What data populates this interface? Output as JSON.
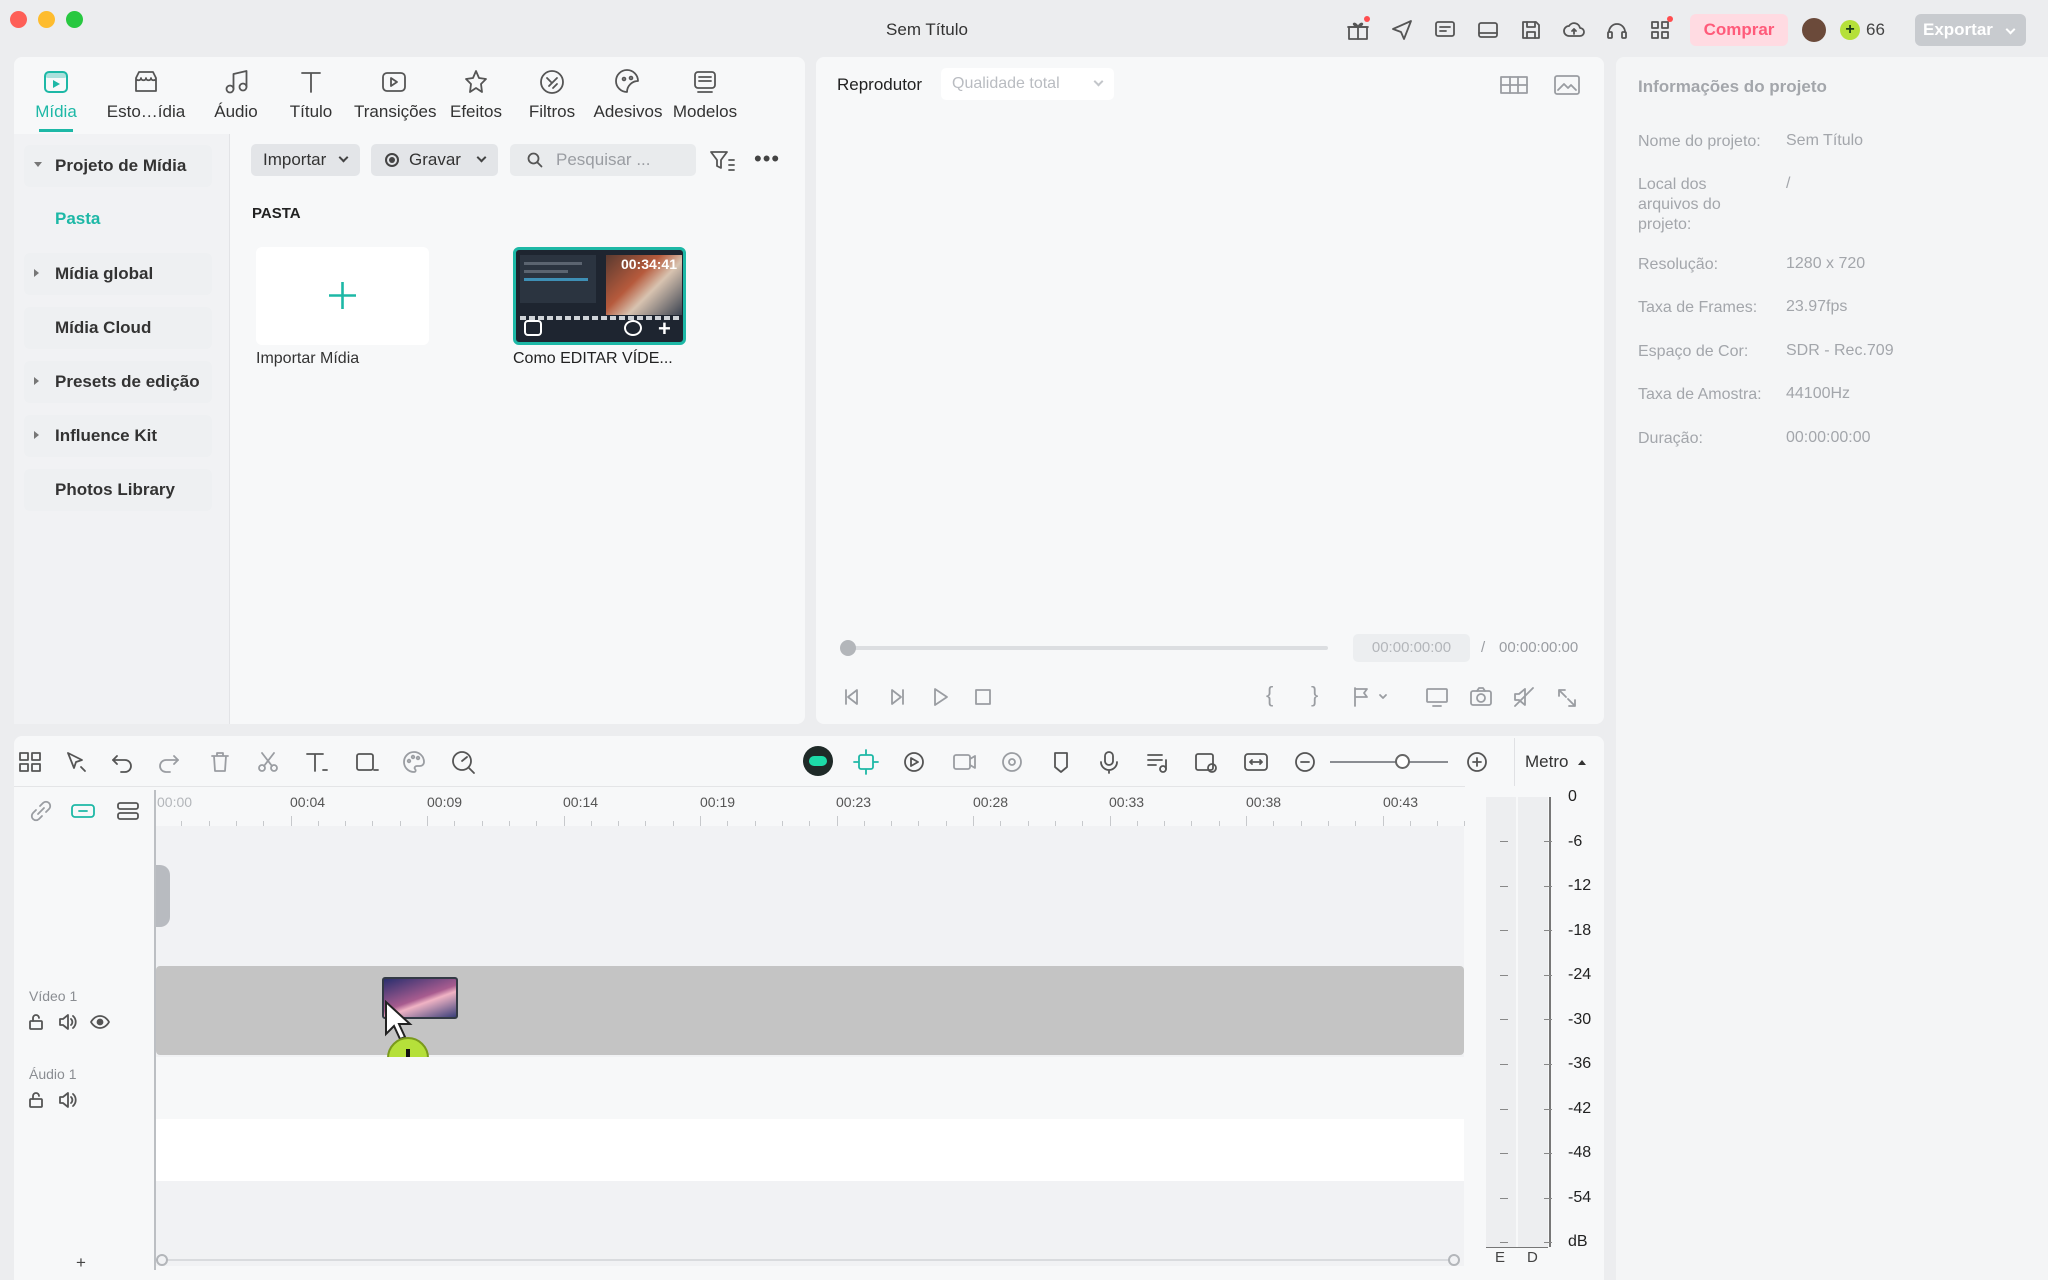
{
  "window": {
    "title": "Sem Título"
  },
  "titlebar": {
    "buy_label": "Comprar",
    "credits": "66",
    "export_label": "Exportar"
  },
  "tabs": [
    {
      "label": "Mídia",
      "icon": "media-icon",
      "active": true
    },
    {
      "label": "Esto…ídia",
      "icon": "stock-media-icon"
    },
    {
      "label": "Áudio",
      "icon": "music-note-icon"
    },
    {
      "label": "Título",
      "icon": "title-text-icon"
    },
    {
      "label": "Transições",
      "icon": "transitions-icon"
    },
    {
      "label": "Efeitos",
      "icon": "effects-icon"
    },
    {
      "label": "Filtros",
      "icon": "filters-icon"
    },
    {
      "label": "Adesivos",
      "icon": "stickers-icon"
    },
    {
      "label": "Modelos",
      "icon": "templates-icon"
    }
  ],
  "sidebar": {
    "items": [
      {
        "label": "Projeto de Mídia",
        "expanded": true
      },
      {
        "label": "Pasta",
        "active": true
      },
      {
        "label": "Mídia global"
      },
      {
        "label": "Mídia Cloud"
      },
      {
        "label": "Presets de edição"
      },
      {
        "label": "Influence Kit"
      },
      {
        "label": "Photos Library"
      }
    ]
  },
  "media_toolbar": {
    "import_label": "Importar",
    "record_label": "Gravar",
    "search_placeholder": "Pesquisar ..."
  },
  "media": {
    "section_label": "PASTA",
    "import_tile_label": "Importar Mídia",
    "clip": {
      "name": "Como EDITAR VÍDE...",
      "duration": "00:34:41"
    }
  },
  "player": {
    "label": "Reprodutor",
    "quality": "Qualidade total",
    "current_time": "00:00:00:00",
    "separator": "/",
    "total_time": "00:00:00:00",
    "progress": 0
  },
  "project_info": {
    "title": "Informações do projeto",
    "rows": [
      {
        "key": "Nome do projeto:",
        "value": "Sem Título"
      },
      {
        "key": "Local dos arquivos do projeto:",
        "value": "/"
      },
      {
        "key": "Resolução:",
        "value": "1280 x 720"
      },
      {
        "key": "Taxa de Frames:",
        "value": "23.97fps"
      },
      {
        "key": "Espaço de Cor:",
        "value": "SDR - Rec.709"
      },
      {
        "key": "Taxa de Amostra:",
        "value": "44100Hz"
      },
      {
        "key": "Duração:",
        "value": "00:00:00:00"
      }
    ]
  },
  "timeline": {
    "meter_label": "Metro",
    "ruler": [
      "00:00",
      "00:04",
      "00:09",
      "00:14",
      "00:19",
      "00:23",
      "00:28",
      "00:33",
      "00:38",
      "00:43"
    ],
    "tracks": [
      {
        "name": "Vídeo 1"
      },
      {
        "name": "Áudio 1"
      }
    ],
    "meter_scale": [
      "0",
      "-6",
      "-12",
      "-18",
      "-24",
      "-30",
      "-36",
      "-42",
      "-48",
      "-54",
      "dB"
    ],
    "meter_channels": [
      "E",
      "D"
    ],
    "add_track": "+"
  },
  "colors": {
    "accent": "#1db8a6",
    "buy": "#ff5b7a",
    "drag_plus": "#b5e03a"
  }
}
